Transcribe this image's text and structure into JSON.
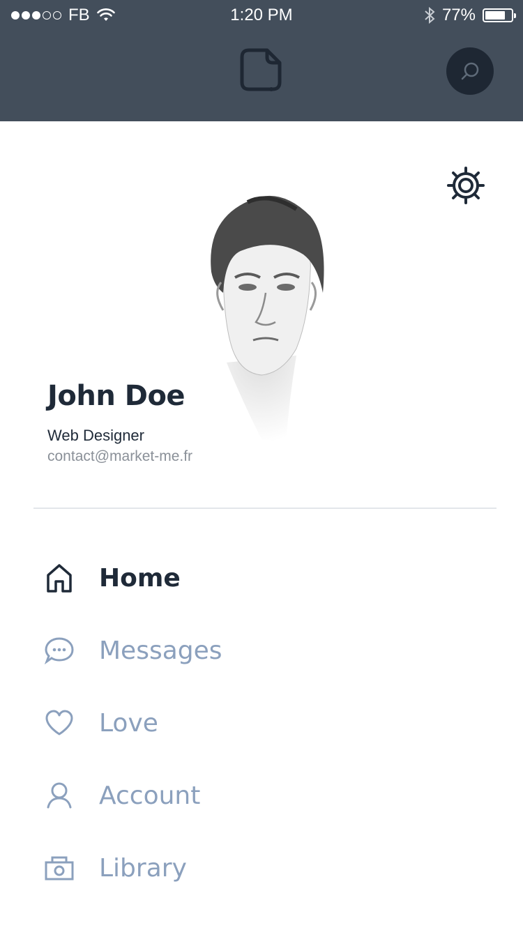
{
  "status_bar": {
    "carrier": "FB",
    "time": "1:20 PM",
    "battery_text": "77%",
    "battery_level": 0.77,
    "signal_dots_filled": 3,
    "signal_dots_total": 5
  },
  "header": {
    "logo_icon": "app-logo-icon",
    "search_icon": "search-icon"
  },
  "settings": {
    "icon": "gear-icon"
  },
  "profile": {
    "name": "John Doe",
    "role": "Web Designer",
    "email": "contact@market-me.fr"
  },
  "menu": {
    "items": [
      {
        "label": "Home",
        "icon": "home-icon",
        "active": true
      },
      {
        "label": "Messages",
        "icon": "chat-bubble-icon",
        "active": false
      },
      {
        "label": "Love",
        "icon": "heart-icon",
        "active": false
      },
      {
        "label": "Account",
        "icon": "user-icon",
        "active": false
      },
      {
        "label": "Library",
        "icon": "camera-icon",
        "active": false
      }
    ]
  },
  "colors": {
    "header_bg": "#434e5b",
    "active_text": "#1f2a38",
    "inactive_text": "#8ba0bd"
  }
}
